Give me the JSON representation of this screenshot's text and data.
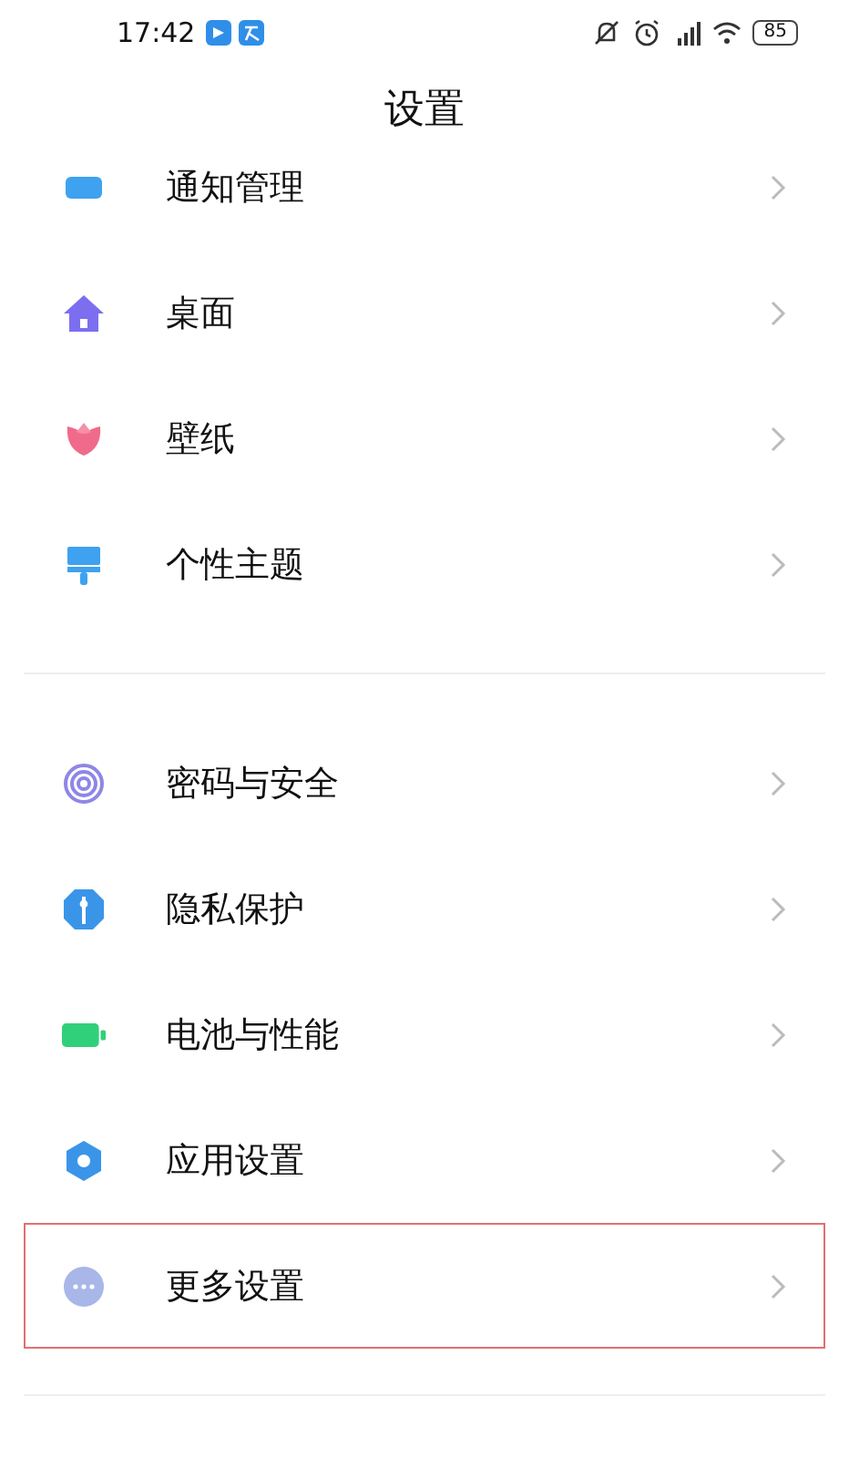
{
  "status_bar": {
    "time": "17:42",
    "battery": "85"
  },
  "title": "设置",
  "groups": [
    {
      "items": [
        {
          "kind": "notifications",
          "label": "通知管理",
          "highlighted": false
        },
        {
          "kind": "desktop",
          "label": "桌面",
          "highlighted": false
        },
        {
          "kind": "wallpaper",
          "label": "壁纸",
          "highlighted": false
        },
        {
          "kind": "theme",
          "label": "个性主题",
          "highlighted": false
        }
      ]
    },
    {
      "items": [
        {
          "kind": "security",
          "label": "密码与安全",
          "highlighted": false
        },
        {
          "kind": "privacy",
          "label": "隐私保护",
          "highlighted": false
        },
        {
          "kind": "battery",
          "label": "电池与性能",
          "highlighted": false
        },
        {
          "kind": "apps",
          "label": "应用设置",
          "highlighted": false
        },
        {
          "kind": "more",
          "label": "更多设置",
          "highlighted": true
        }
      ]
    }
  ]
}
